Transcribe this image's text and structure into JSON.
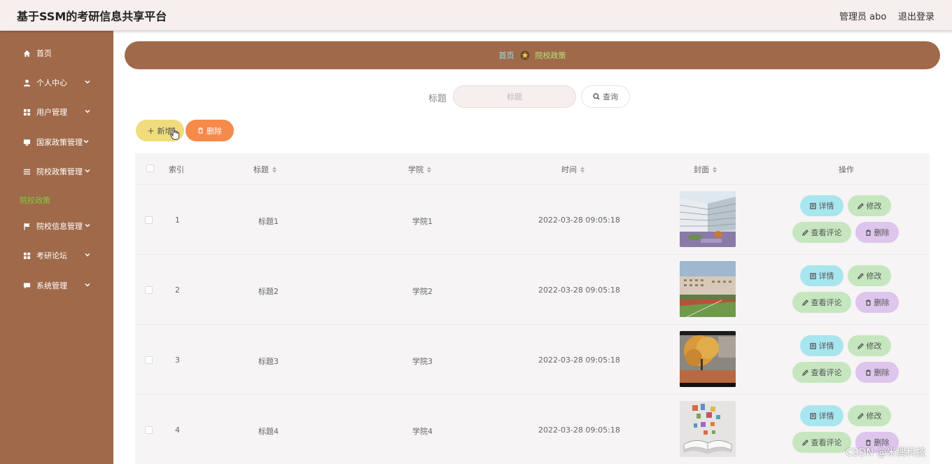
{
  "header": {
    "app_title": "基于SSM的考研信息共享平台",
    "admin_label": "管理员 abo",
    "logout_label": "退出登录"
  },
  "sidebar": {
    "items": [
      {
        "label": "首页",
        "icon": "home-icon",
        "has_arrow": false
      },
      {
        "label": "个人中心",
        "icon": "user-icon",
        "has_arrow": true
      },
      {
        "label": "用户管理",
        "icon": "grid-icon",
        "has_arrow": true
      },
      {
        "label": "国家政策管理",
        "icon": "monitor-icon",
        "has_arrow": true
      },
      {
        "label": "院校政策管理",
        "icon": "list-icon",
        "has_arrow": true
      },
      {
        "label": "院校信息管理",
        "icon": "flag-icon",
        "has_arrow": true
      },
      {
        "label": "考研论坛",
        "icon": "grid-icon",
        "has_arrow": true
      },
      {
        "label": "系统管理",
        "icon": "chat-icon",
        "has_arrow": true
      }
    ],
    "active_sub": "院校政策"
  },
  "breadcrumb": {
    "home": "首页",
    "current": "院校政策"
  },
  "search": {
    "label": "标题",
    "placeholder": "标题",
    "button_label": "查询"
  },
  "actions": {
    "add_label": "新增",
    "delete_label": "删除"
  },
  "table": {
    "columns": [
      "索引",
      "标题",
      "学院",
      "时间",
      "封面",
      "操作"
    ],
    "rows": [
      {
        "index": "1",
        "title": "标题1",
        "college": "学院1",
        "time": "2022-03-28 09:05:18",
        "cover": "modern-campus-building"
      },
      {
        "index": "2",
        "title": "标题2",
        "college": "学院2",
        "time": "2022-03-28 09:05:18",
        "cover": "campus-sports-field"
      },
      {
        "index": "3",
        "title": "标题3",
        "college": "学院3",
        "time": "2022-03-28 09:05:18",
        "cover": "autumn-tree"
      },
      {
        "index": "4",
        "title": "标题4",
        "college": "学院4",
        "time": "2022-03-28 09:05:18",
        "cover": "open-book"
      }
    ],
    "row_buttons": {
      "detail": "详情",
      "edit": "修改",
      "comment": "查看评论",
      "delete": "删除"
    }
  },
  "watermark": "CSDN @米偶科技"
}
